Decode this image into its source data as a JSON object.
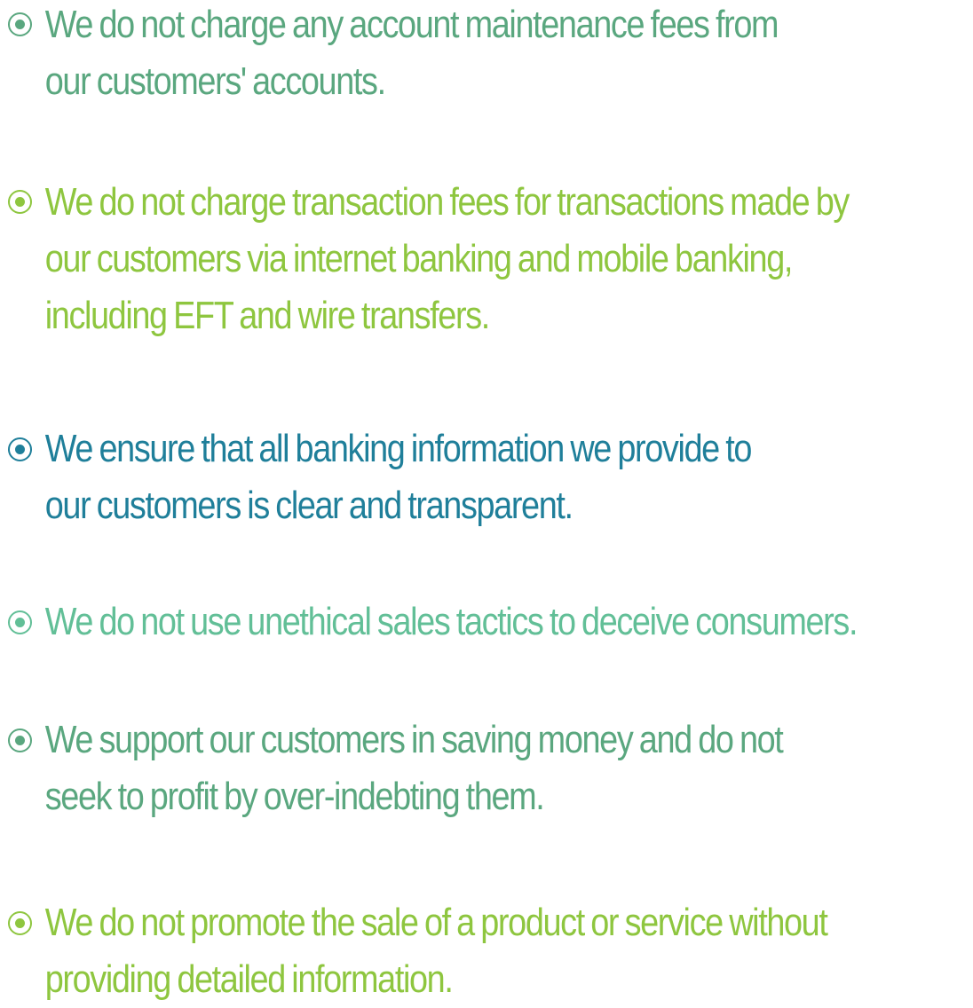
{
  "items": [
    {
      "lines": [
        "We do not charge any account maintenance fees from",
        "our customers' accounts."
      ],
      "color": "#5aa77f"
    },
    {
      "lines": [
        "We do not charge transaction fees for transactions made by",
        "our customers via internet banking and mobile banking,",
        "including EFT and wire transfers."
      ],
      "color": "#8ec63f"
    },
    {
      "lines": [
        "We ensure that all banking information we provide to",
        "our customers is clear and transparent."
      ],
      "color": "#1f7f9a"
    },
    {
      "lines": [
        "We do not use unethical sales tactics to deceive consumers."
      ],
      "color": "#62bf97"
    },
    {
      "lines": [
        "We support our customers in saving money and do not",
        "seek to profit by over-indebting them."
      ],
      "color": "#5aa77f"
    },
    {
      "lines": [
        "We do not promote the sale of a product or service without",
        "providing detailed information."
      ],
      "color": "#8ec63f"
    }
  ],
  "icons": {
    "bullet": "radio-bullet-icon"
  }
}
